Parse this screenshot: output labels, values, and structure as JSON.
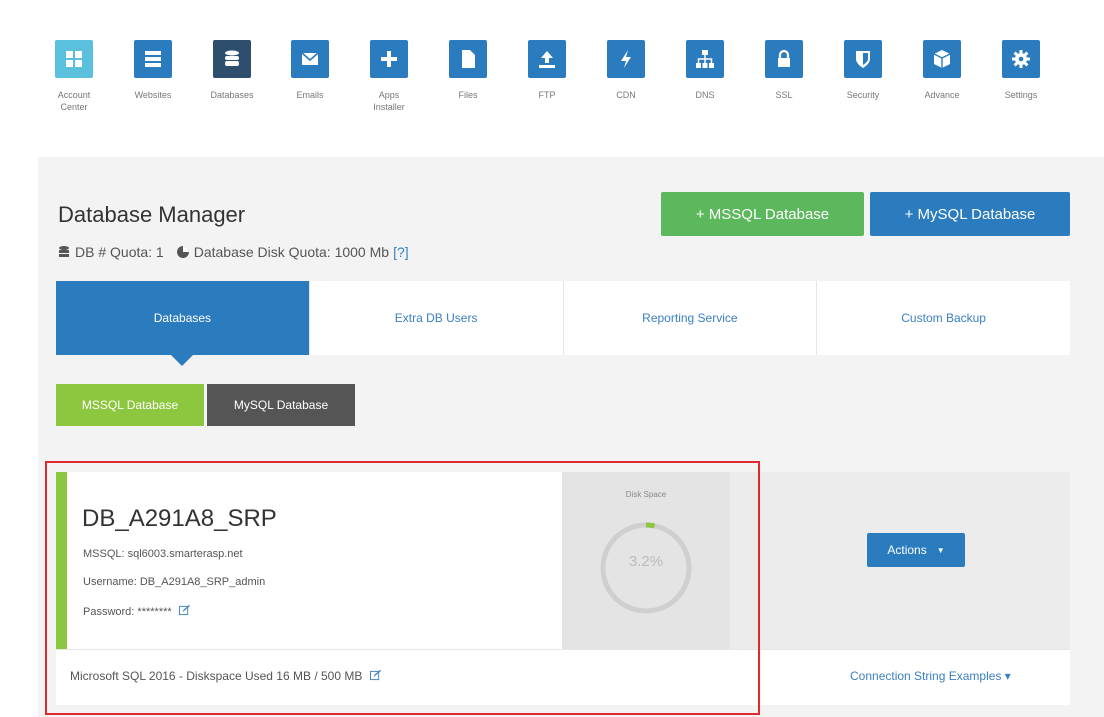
{
  "nav": [
    {
      "label": "Account\nCenter",
      "icon": "grid-icon",
      "color": "#5bc0de"
    },
    {
      "label": "Websites",
      "icon": "server-icon",
      "color": "#2b7bbf"
    },
    {
      "label": "Databases",
      "icon": "database-icon",
      "color": "#2e4e6e"
    },
    {
      "label": "Emails",
      "icon": "envelope-icon",
      "color": "#2b7bbf"
    },
    {
      "label": "Apps\nInstaller",
      "icon": "plus-icon",
      "color": "#2b7bbf"
    },
    {
      "label": "Files",
      "icon": "file-icon",
      "color": "#2b7bbf"
    },
    {
      "label": "FTP",
      "icon": "upload-icon",
      "color": "#2b7bbf"
    },
    {
      "label": "CDN",
      "icon": "bolt-icon",
      "color": "#2b7bbf"
    },
    {
      "label": "DNS",
      "icon": "sitemap-icon",
      "color": "#2b7bbf"
    },
    {
      "label": "SSL",
      "icon": "lock-icon",
      "color": "#2b7bbf"
    },
    {
      "label": "Security",
      "icon": "shield-icon",
      "color": "#2b7bbf"
    },
    {
      "label": "Advance",
      "icon": "cube-icon",
      "color": "#2b7bbf"
    },
    {
      "label": "Settings",
      "icon": "gear-icon",
      "color": "#2b7bbf"
    }
  ],
  "header": {
    "title": "Database Manager",
    "db_quota": "DB # Quota: 1",
    "disk_quota": "Database Disk Quota: 1000 Mb",
    "help": "[?]",
    "btn_mssql": "+ MSSQL Database",
    "btn_mysql": "+ MySQL Database"
  },
  "tabs": [
    "Databases",
    "Extra DB Users",
    "Reporting Service",
    "Custom Backup"
  ],
  "subtabs": {
    "mssql": "MSSQL Database",
    "mysql": "MySQL Database"
  },
  "database": {
    "name": "DB_A291A8_SRP",
    "server": "MSSQL: sql6003.smarterasp.net",
    "username": "Username: DB_A291A8_SRP_admin",
    "password": "Password: ********",
    "disk_label": "Disk Space",
    "disk_percent": "3.2%",
    "disk_fraction": 0.032,
    "actions": "Actions",
    "footer": "Microsoft SQL 2016 - Diskspace Used 16 MB / 500 MB",
    "conn_link": "Connection String Examples ▾"
  },
  "colors": {
    "accent": "#2b7bbf",
    "green": "#5cb85c",
    "lime": "#8dc63f",
    "highlight": "#e0282e"
  }
}
